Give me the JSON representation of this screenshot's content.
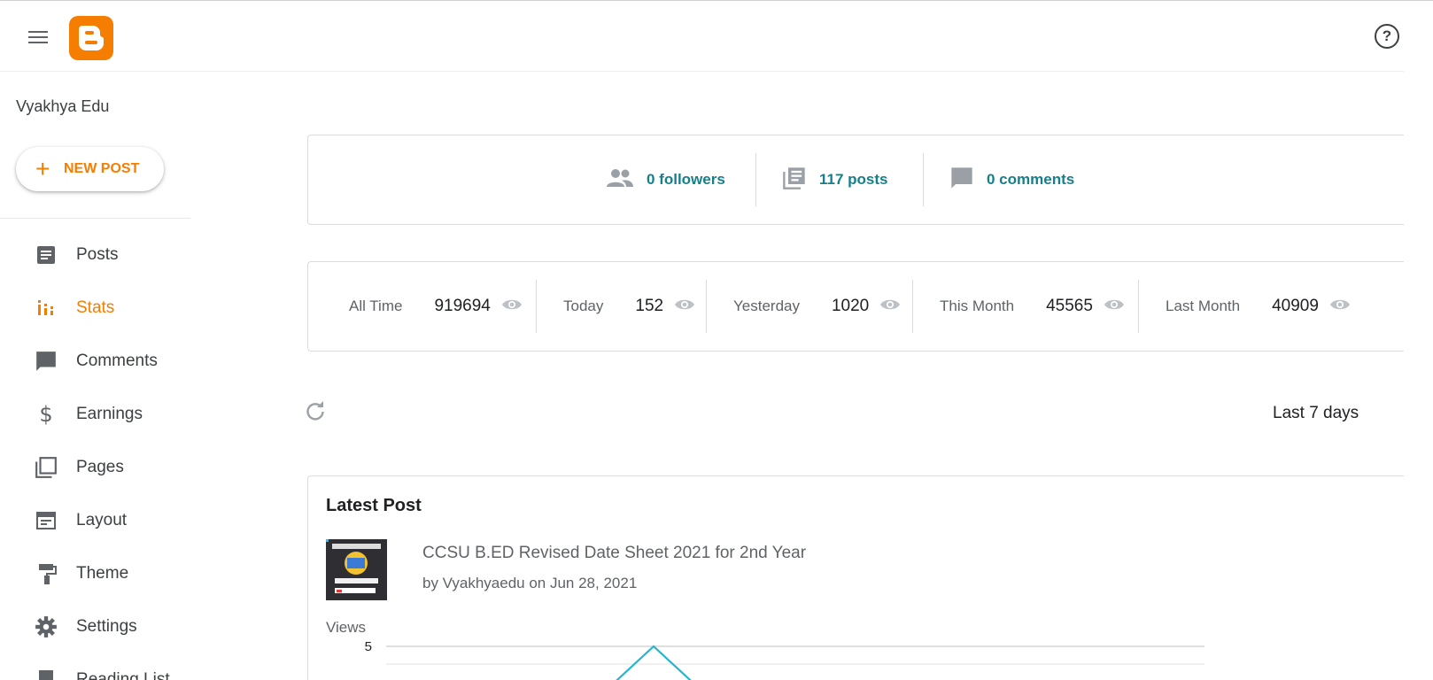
{
  "sidebar": {
    "blog_name": "Vyakhya Edu",
    "new_post_label": "NEW POST",
    "items": [
      {
        "label": "Posts",
        "icon": "posts-icon"
      },
      {
        "label": "Stats",
        "icon": "stats-icon",
        "active": true
      },
      {
        "label": "Comments",
        "icon": "comment-icon"
      },
      {
        "label": "Earnings",
        "icon": "dollar-icon"
      },
      {
        "label": "Pages",
        "icon": "pages-icon"
      },
      {
        "label": "Layout",
        "icon": "layout-icon"
      },
      {
        "label": "Theme",
        "icon": "paint-roller-icon"
      },
      {
        "label": "Settings",
        "icon": "gear-icon"
      },
      {
        "label": "Reading List",
        "icon": "bookmark-icon"
      }
    ]
  },
  "summary": {
    "followers": "0 followers",
    "posts": "117 posts",
    "comments": "0 comments"
  },
  "views": [
    {
      "label": "All Time",
      "value": "919694"
    },
    {
      "label": "Today",
      "value": "152"
    },
    {
      "label": "Yesterday",
      "value": "1020"
    },
    {
      "label": "This Month",
      "value": "45565"
    },
    {
      "label": "Last Month",
      "value": "40909"
    }
  ],
  "range_label": "Last 7 days",
  "latest_post": {
    "heading": "Latest Post",
    "title": "CCSU B.ED Revised Date Sheet 2021 for 2nd Year",
    "meta": "by Vyakhyaedu on Jun 28, 2021",
    "views_label": "Views"
  },
  "chart_data": {
    "type": "line",
    "yticks": [
      "5"
    ],
    "series": [
      {
        "values": [
          5
        ]
      }
    ]
  },
  "colors": {
    "accent": "#f57d00",
    "link": "#16808a",
    "line": "#26b5cf"
  }
}
